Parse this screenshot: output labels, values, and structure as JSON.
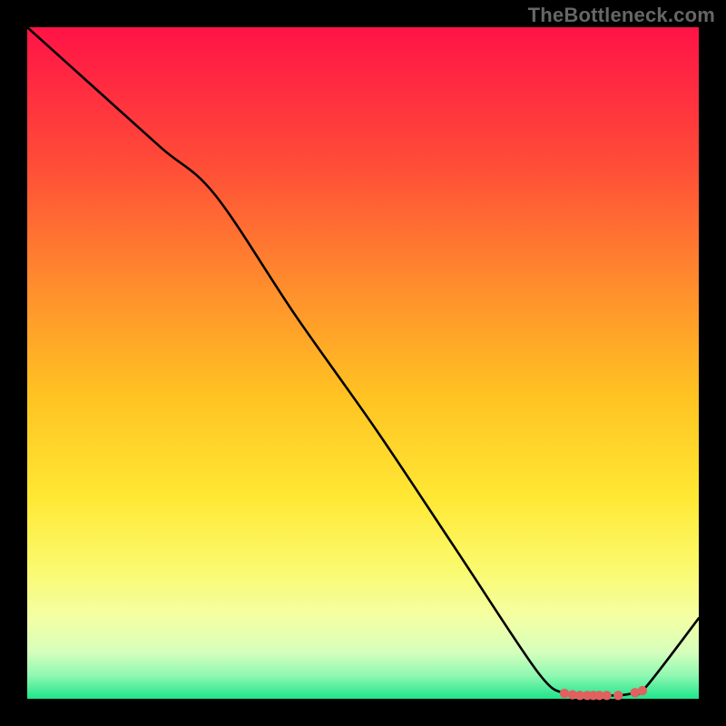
{
  "attribution": "TheBottleneck.com",
  "colors": {
    "bg": "#000000",
    "curve": "#000000",
    "marker": "#e0615f",
    "gradient_stops": [
      {
        "offset": 0.0,
        "color": "#ff1347"
      },
      {
        "offset": 0.2,
        "color": "#ff4b38"
      },
      {
        "offset": 0.4,
        "color": "#ff922c"
      },
      {
        "offset": 0.55,
        "color": "#ffc322"
      },
      {
        "offset": 0.7,
        "color": "#ffe834"
      },
      {
        "offset": 0.8,
        "color": "#fbf96a"
      },
      {
        "offset": 0.88,
        "color": "#f3ffa4"
      },
      {
        "offset": 0.93,
        "color": "#d6ffbc"
      },
      {
        "offset": 0.965,
        "color": "#90f8b2"
      },
      {
        "offset": 1.0,
        "color": "#1ee58b"
      }
    ]
  },
  "chart_data": {
    "type": "line",
    "title": "",
    "xlabel": "",
    "ylabel": "",
    "xlim": [
      0,
      100
    ],
    "ylim": [
      0,
      100
    ],
    "series": [
      {
        "name": "curve",
        "x": [
          0,
          10,
          20,
          28,
          40,
          52,
          64,
          76,
          80,
          82,
          84,
          86,
          88,
          90,
          92,
          100
        ],
        "y": [
          100,
          91,
          82,
          75,
          57,
          40,
          22,
          4,
          0.8,
          0.5,
          0.5,
          0.5,
          0.5,
          0.8,
          1.6,
          12
        ]
      }
    ],
    "markers": {
      "name": "optimal-range",
      "x": [
        80.0,
        81.2,
        82.3,
        83.4,
        84.3,
        85.2,
        86.3,
        88.0,
        90.5,
        91.6
      ],
      "y": [
        0.8,
        0.6,
        0.5,
        0.5,
        0.5,
        0.5,
        0.5,
        0.5,
        0.9,
        1.2
      ]
    }
  }
}
